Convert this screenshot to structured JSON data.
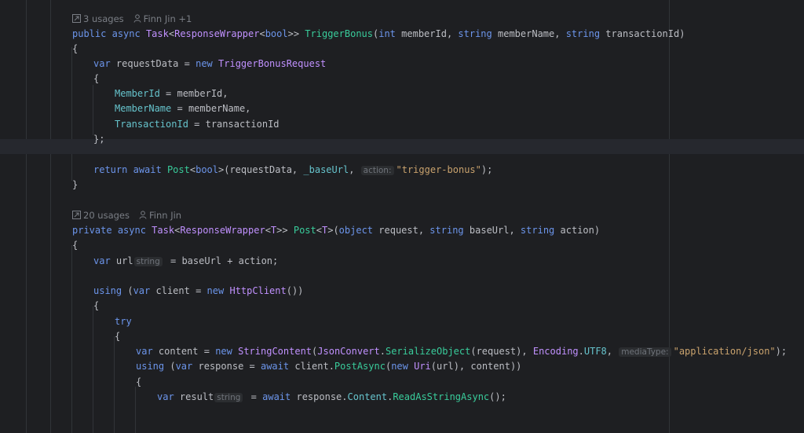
{
  "editor": {
    "lens1": {
      "usages": "3 usages",
      "author": "Finn Jin +1"
    },
    "lens2": {
      "usages": "20 usages",
      "author": "Finn Jin"
    },
    "method1": {
      "kw_public": "public",
      "kw_async": "async",
      "ret_task": "Task",
      "ret_wrapper": "ResponseWrapper",
      "ret_bool": "bool",
      "name": "TriggerBonus",
      "p1_type": "int",
      "p1_name": "memberId",
      "p2_type": "string",
      "p2_name": "memberName",
      "p3_type": "string",
      "p3_name": "transactionId",
      "open": "{",
      "close": "}",
      "l1_var": "var",
      "l1_name": "requestData",
      "l1_new": "new",
      "l1_type": "TriggerBonusRequest",
      "init_open": "{",
      "f1": "MemberId",
      "f1_val": "memberId,",
      "f2": "MemberName",
      "f2_val": "memberName,",
      "f3": "TransactionId",
      "f3_val": "transactionId",
      "init_close": "};",
      "ret_kw": "return",
      "await_kw": "await",
      "post_fn": "Post",
      "post_type": "bool",
      "args_a": "(requestData, ",
      "base_url": "_baseUrl",
      "hint_action": "action:",
      "action_str": "\"trigger-bonus\"",
      "args_end": ");"
    },
    "method2": {
      "kw_private": "private",
      "kw_async": "async",
      "ret_task": "Task",
      "ret_wrapper": "ResponseWrapper",
      "ret_t": "T",
      "name": "Post",
      "gen_t": "T",
      "p1_type": "object",
      "p1_name": "request",
      "p2_type": "string",
      "p2_name": "baseUrl",
      "p3_type": "string",
      "p3_name": "action",
      "open": "{",
      "url_var": "var",
      "url_name": "url",
      "url_hint": "string",
      "url_expr": " = baseUrl + action;",
      "using_kw": "using",
      "using_var": "var",
      "client_name": "client",
      "using_new": "new",
      "httpclient": "HttpClient",
      "using_end": "())",
      "using_open": "{",
      "try_kw": "try",
      "try_open": "{",
      "content_var": "var",
      "content_name": "content",
      "content_new": "new",
      "stringcontent": "StringContent",
      "jsonconvert": "JsonConvert",
      "serialize": "SerializeObject",
      "req_arg": "(request), ",
      "encoding": "Encoding",
      "utf8": "UTF8",
      "hint_media": "mediaType:",
      "media_str": "\"application/json\"",
      "content_end": ");",
      "using2_kw": "using",
      "using2_var": "var",
      "response_name": "response",
      "using2_await": "await",
      "client_ref": "client.",
      "postasync": "PostAsync",
      "using2_new": "new",
      "uri": "Uri",
      "using2_end": "(url), content))",
      "using2_open": "{",
      "result_var": "var",
      "result_name": "result",
      "result_hint": "string",
      "result_await": "await",
      "resp_ref": "response.",
      "content_prop": "Content",
      "readasync": "ReadAsStringAsync",
      "result_end": "();"
    }
  }
}
